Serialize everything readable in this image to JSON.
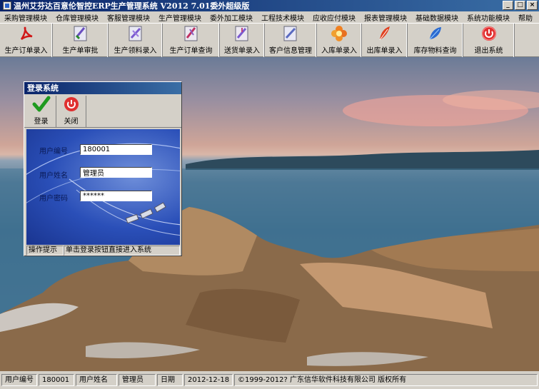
{
  "window": {
    "title": "温州艾芬达百意伦智控ERP生产管理系统 V2012 7.01委外超级版",
    "controls": [
      "_",
      "□",
      "×"
    ]
  },
  "menu": [
    "采购管理模块",
    "仓库管理模块",
    "客服管理模块",
    "生产管理模块",
    "委外加工模块",
    "工程技术模块",
    "应收应付模块",
    "报表管理模块",
    "基础数据模块",
    "系统功能模块",
    "帮助"
  ],
  "toolbar": [
    {
      "label": "生产订单录入",
      "icon": "pdf-icon"
    },
    {
      "label": "生产单审批",
      "icon": "approve-doc-icon"
    },
    {
      "label": "生产领料录入",
      "icon": "material-doc-icon"
    },
    {
      "label": "生产订单查询",
      "icon": "query-doc-icon"
    },
    {
      "label": "送货单录入",
      "icon": "delivery-doc-icon"
    },
    {
      "label": "客户信息管理",
      "icon": "customer-doc-icon"
    },
    {
      "label": "入库单录入",
      "icon": "flower-icon"
    },
    {
      "label": "出库单录入",
      "icon": "feather-icon"
    },
    {
      "label": "库存物料查询",
      "icon": "leaf-icon"
    },
    {
      "label": "退出系统",
      "icon": "power-icon"
    }
  ],
  "login": {
    "title": "登录系统",
    "login_button": "登录",
    "close_button": "关闭",
    "user_id_label": "用户编号",
    "user_id_value": "180001",
    "user_name_label": "用户姓名",
    "user_name_value": "管理员",
    "password_label": "用户密码",
    "password_value": "******",
    "hint_label": "操作提示",
    "hint_text": "单击登录按钮直接进入系统"
  },
  "status": {
    "user_id_label": "用户编号",
    "user_id": "180001",
    "user_name_label": "用户姓名",
    "user_name": "管理员",
    "date_label": "日期",
    "date": "2012-12-18",
    "copyright": "©1999-2012?  广东信华软件科技有限公司  版权所有"
  },
  "colors": {
    "title_bar": "#0a246a",
    "face": "#d4d0c8",
    "login_panel": "#2a4fb8"
  }
}
